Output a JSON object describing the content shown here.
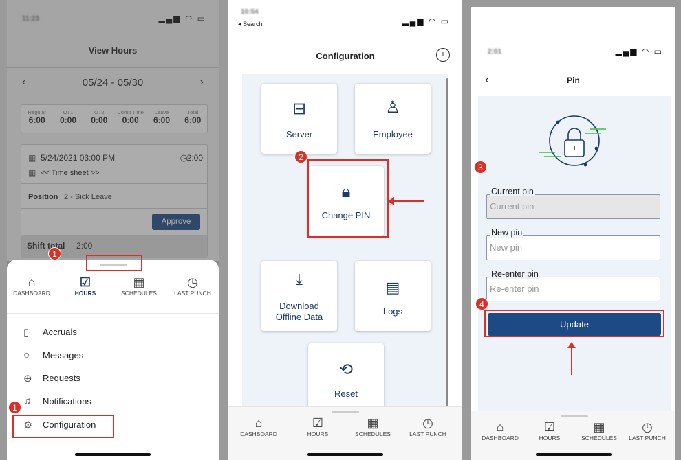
{
  "panel1": {
    "status_time": "11:23",
    "title": "View Hours",
    "date_range": "05/24 - 05/30",
    "summary": [
      {
        "label": "Regular",
        "value": "6:00"
      },
      {
        "label": "OT1",
        "value": "0:00"
      },
      {
        "label": "OT2",
        "value": "0:00"
      },
      {
        "label": "Comp Time",
        "value": "0:00"
      },
      {
        "label": "Leave",
        "value": "6:00"
      },
      {
        "label": "Total",
        "value": "6:00"
      }
    ],
    "entry": {
      "datetime": "5/24/2021 03:00 PM",
      "duration": "2:00",
      "timesheet": "<< Time sheet >>",
      "position_label": "Position",
      "position_value": "2 - Sick Leave",
      "approve_label": "Approve"
    },
    "shift_total_label": "Shift total",
    "shift_total_value": "2:00",
    "nav": [
      "DASHBOARD",
      "HOURS",
      "SCHEDULES",
      "LAST PUNCH"
    ],
    "menu": [
      "Accruals",
      "Messages",
      "Requests",
      "Notifications",
      "Configuration"
    ],
    "badges": [
      "1",
      "1"
    ]
  },
  "panel2": {
    "status_time": "10:54",
    "back_label": "◂ Search",
    "title": "Configuration",
    "cards": {
      "server": "Server",
      "employee": "Employee",
      "change_pin": "Change PIN",
      "download_l1": "Download",
      "download_l2": "Offline Data",
      "logs": "Logs",
      "reset": "Reset"
    },
    "nav": [
      "DASHBOARD",
      "HOURS",
      "SCHEDULES",
      "LAST PUNCH"
    ],
    "badge": "2"
  },
  "panel3": {
    "status_time": "2:01",
    "title": "Pin",
    "current_label": "Current pin",
    "current_placeholder": "Current pin",
    "new_label": "New pin",
    "new_placeholder": "New pin",
    "reenter_label": "Re-enter pin",
    "reenter_placeholder": "Re-enter pin",
    "update_label": "Update",
    "nav": [
      "DASHBOARD",
      "HOURS",
      "SCHEDULES",
      "LAST PUNCH"
    ],
    "badges": [
      "3",
      "4"
    ]
  },
  "colors": {
    "accent": "#1a3a6b",
    "highlight": "#d9302a",
    "primary_button": "#1d4a85",
    "lock_accent": "#39c23a"
  }
}
